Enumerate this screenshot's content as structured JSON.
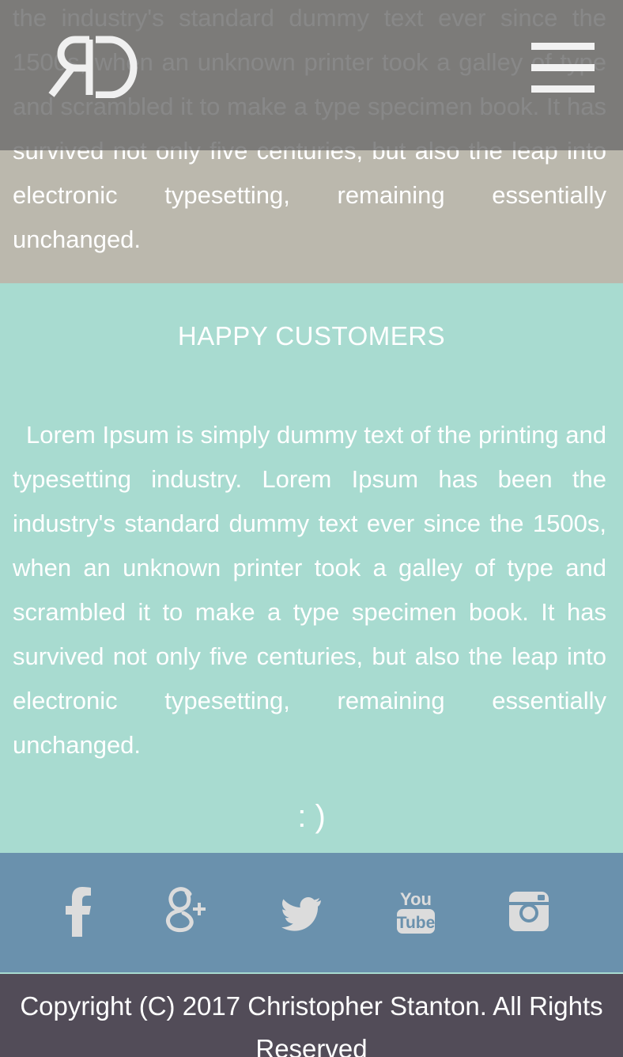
{
  "top": {
    "paragraph": "the industry's standard dummy text ever since the 1500s, when an unknown printer took a galley of type and scrambled it to make a type specimen book. It has survived not only five centuries, but also the leap into electronic typesetting, remaining essentially unchanged."
  },
  "header": {
    "logo_text": "RD",
    "menu_icon": "hamburger-menu-icon"
  },
  "customers": {
    "heading": "HAPPY CUSTOMERS",
    "paragraph": "Lorem Ipsum is simply dummy text of the printing and typesetting industry. Lorem Ipsum has been the industry's standard dummy text ever since the 1500s, when an unknown printer took a galley of type and scrambled it to make a type specimen book. It has survived not only five centuries, but also the leap into electronic typesetting, remaining essentially unchanged.",
    "smile": ": )"
  },
  "social": {
    "icons": [
      "facebook-icon",
      "google-plus-icon",
      "twitter-icon",
      "youtube-icon",
      "instagram-icon"
    ],
    "youtube_you": "You",
    "youtube_tube": "Tube"
  },
  "footer": {
    "copyright": "Copyright (C) 2017 Christopher Stanton. All Rights Reserved"
  },
  "colors": {
    "top_bg": "#bbb8ad",
    "header_overlay": "#6e6e6e",
    "customers_bg": "#a8dbd0",
    "social_bg": "#6a91ad",
    "footer_bg": "#524c58",
    "icon_color": "#dcdcdc"
  }
}
